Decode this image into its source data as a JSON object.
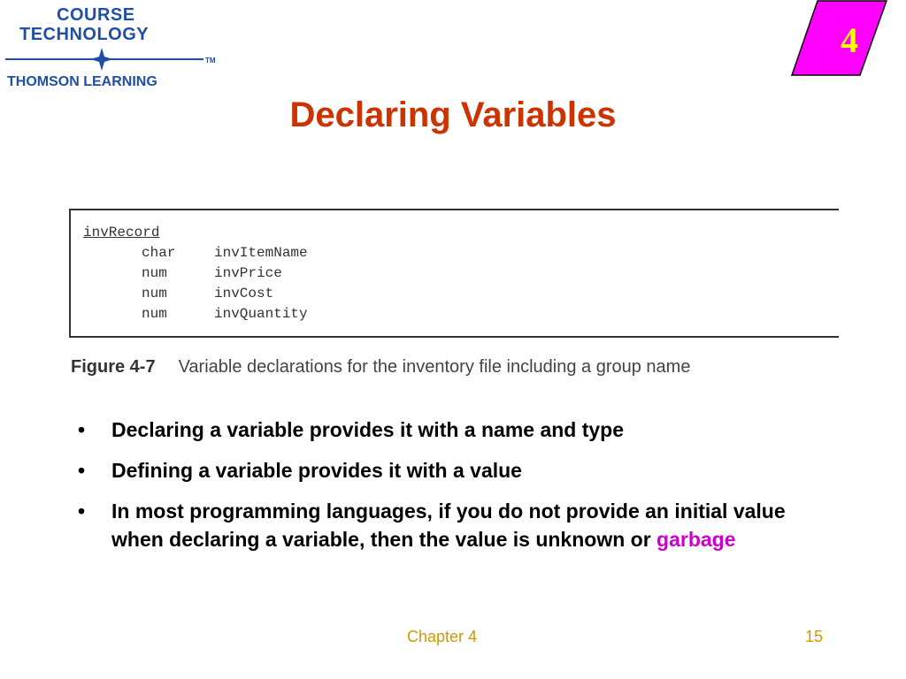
{
  "logo": {
    "line1": "COURSE",
    "line2": "TECHNOLOGY",
    "line3": "THOMSON LEARNING",
    "tm": "TM"
  },
  "chapter_badge": "4",
  "title": "Declaring Variables",
  "figure": {
    "group_name": "invRecord",
    "rows": [
      {
        "type": "char",
        "name": "invItemName"
      },
      {
        "type": "num",
        "name": "invPrice"
      },
      {
        "type": "num",
        "name": "invCost"
      },
      {
        "type": "num",
        "name": "invQuantity"
      }
    ],
    "caption_label": "Figure 4-7",
    "caption_text": "Variable declarations for the inventory file including a group name"
  },
  "bullets": [
    {
      "text": "Declaring a variable provides it with a name and type"
    },
    {
      "text": "Defining a variable provides it with a value"
    },
    {
      "text": "In most programming languages, if you do not provide an initial value when declaring a variable, then the value is unknown or ",
      "highlight": "garbage"
    }
  ],
  "bullet_symbol": "•",
  "footer": {
    "chapter": "Chapter 4",
    "page": "15"
  },
  "colors": {
    "title": "#cc3300",
    "tab": "#ff00ff",
    "tab_number": "#ffff00",
    "highlight": "#cc00cc",
    "footer": "#cc9900",
    "logo": "#1f4fa6"
  }
}
